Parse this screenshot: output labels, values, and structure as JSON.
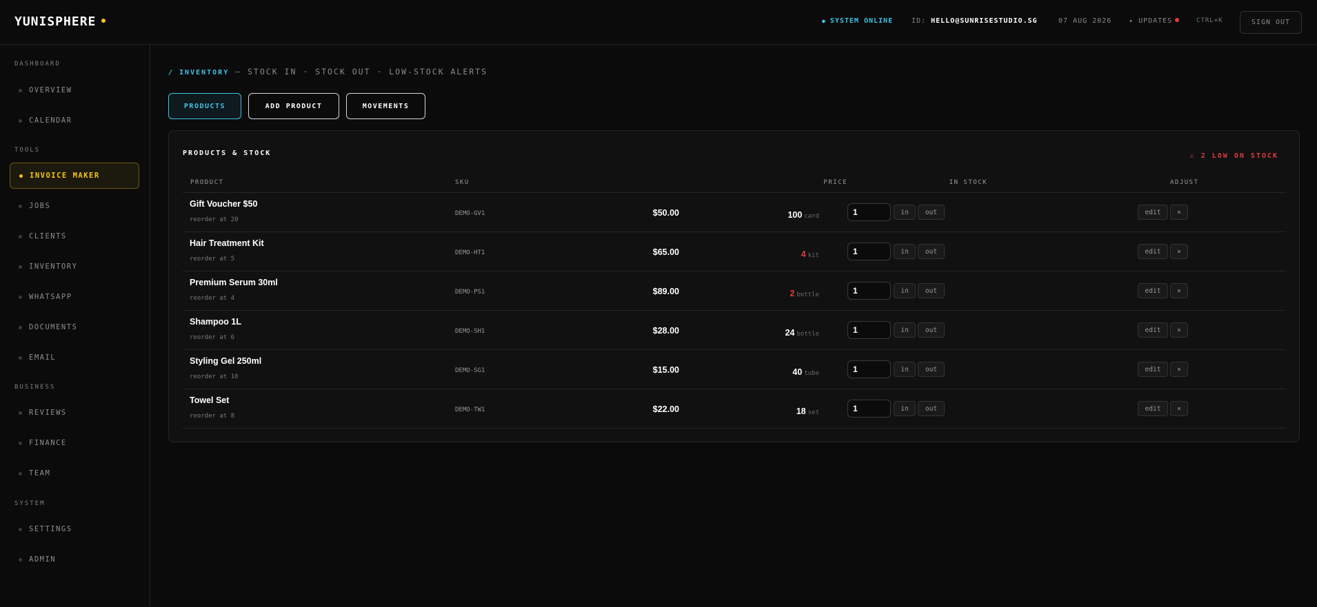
{
  "app": {
    "brand": "YUNISPHERE"
  },
  "topbar": {
    "status": "SYSTEM ONLINE",
    "id_label": "ID:",
    "id_value": "HELLO@SUNRISESTUDIO.SG",
    "date": "07 AUG 2026",
    "updates": "UPDATES",
    "shortcut": "CTRL+K",
    "signout": "SIGN OUT"
  },
  "sidebar": {
    "sections": [
      {
        "label": "DASHBOARD",
        "items": [
          "OVERVIEW",
          "CALENDAR"
        ]
      },
      {
        "label": "TOOLS",
        "items": [
          "INVOICE MAKER",
          "JOBS",
          "CLIENTS",
          "INVENTORY",
          "WHATSAPP",
          "DOCUMENTS",
          "EMAIL"
        ]
      },
      {
        "label": "BUSINESS",
        "items": [
          "REVIEWS",
          "FINANCE",
          "TEAM"
        ]
      },
      {
        "label": "SYSTEM",
        "items": [
          "SETTINGS",
          "ADMIN"
        ]
      }
    ],
    "active_item": "INVOICE MAKER"
  },
  "main": {
    "breadcrumb": {
      "current": "/ INVENTORY",
      "rest": " — STOCK IN · STOCK OUT · LOW-STOCK ALERTS"
    },
    "tabs": [
      "PRODUCTS",
      "ADD PRODUCT",
      "MOVEMENTS"
    ],
    "active_tab": "PRODUCTS",
    "panel": {
      "title": "PRODUCTS & STOCK",
      "alert": "⚠ 2 LOW ON STOCK",
      "columns": {
        "product": "PRODUCT",
        "sku": "SKU",
        "price": "PRICE",
        "stock": "IN STOCK",
        "adjust": "ADJUST"
      },
      "rows": [
        {
          "name": "Gift Voucher $50",
          "reorder": "reorder at 20",
          "sku": "DEMO-GV1",
          "price": "$50.00",
          "qty": "100",
          "unit": "card",
          "low": false,
          "adjust": "1"
        },
        {
          "name": "Hair Treatment Kit",
          "reorder": "reorder at 5",
          "sku": "DEMO-HT1",
          "price": "$65.00",
          "qty": "4",
          "unit": "kit",
          "low": true,
          "adjust": "1"
        },
        {
          "name": "Premium Serum 30ml",
          "reorder": "reorder at 4",
          "sku": "DEMO-PS1",
          "price": "$89.00",
          "qty": "2",
          "unit": "bottle",
          "low": true,
          "adjust": "1"
        },
        {
          "name": "Shampoo 1L",
          "reorder": "reorder at 6",
          "sku": "DEMO-SH1",
          "price": "$28.00",
          "qty": "24",
          "unit": "bottle",
          "low": false,
          "adjust": "1"
        },
        {
          "name": "Styling Gel 250ml",
          "reorder": "reorder at 10",
          "sku": "DEMO-SG1",
          "price": "$15.00",
          "qty": "40",
          "unit": "tube",
          "low": false,
          "adjust": "1"
        },
        {
          "name": "Towel Set",
          "reorder": "reorder at 8",
          "sku": "DEMO-TW1",
          "price": "$22.00",
          "qty": "18",
          "unit": "set",
          "low": false,
          "adjust": "1"
        }
      ],
      "row_actions": {
        "in": "in",
        "out": "out",
        "edit": "edit",
        "delete": "×"
      }
    }
  },
  "colors": {
    "accent": "#3ec3e6",
    "brand_yellow": "#f5c518",
    "danger": "#e23b3b"
  }
}
